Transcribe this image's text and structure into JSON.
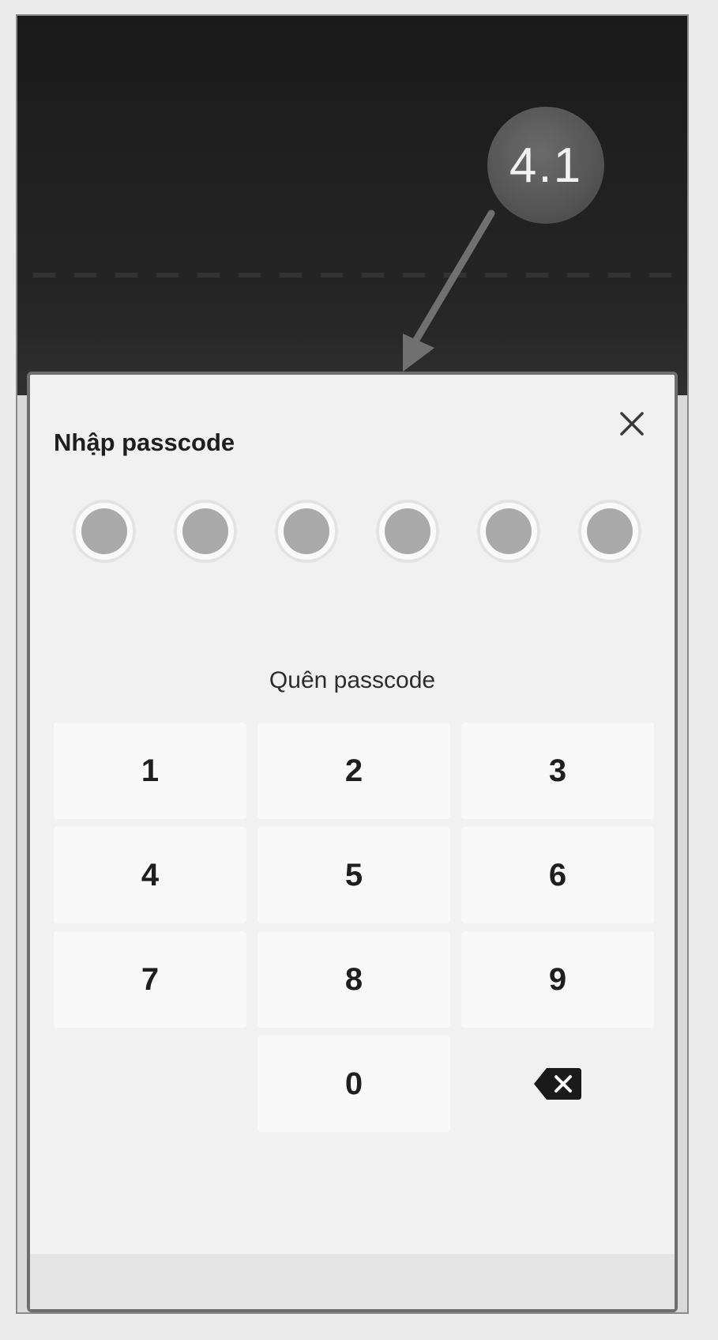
{
  "annotation": {
    "step_label": "4.1"
  },
  "dialog": {
    "title": "Nhập passcode",
    "close_icon": "close-icon",
    "passcode_length": 6,
    "entered_digits": 0,
    "forgot_label": "Quên passcode"
  },
  "keypad": {
    "keys": [
      "1",
      "2",
      "3",
      "4",
      "5",
      "6",
      "7",
      "8",
      "9",
      "0"
    ],
    "backspace_icon": "backspace-icon"
  },
  "colors": {
    "backdrop": "#1a1a1a",
    "badge": "#555555",
    "dot_fill": "#a9a9a9",
    "sheet_bg": "#f1f1f1",
    "key_bg": "#f9f9f9"
  }
}
